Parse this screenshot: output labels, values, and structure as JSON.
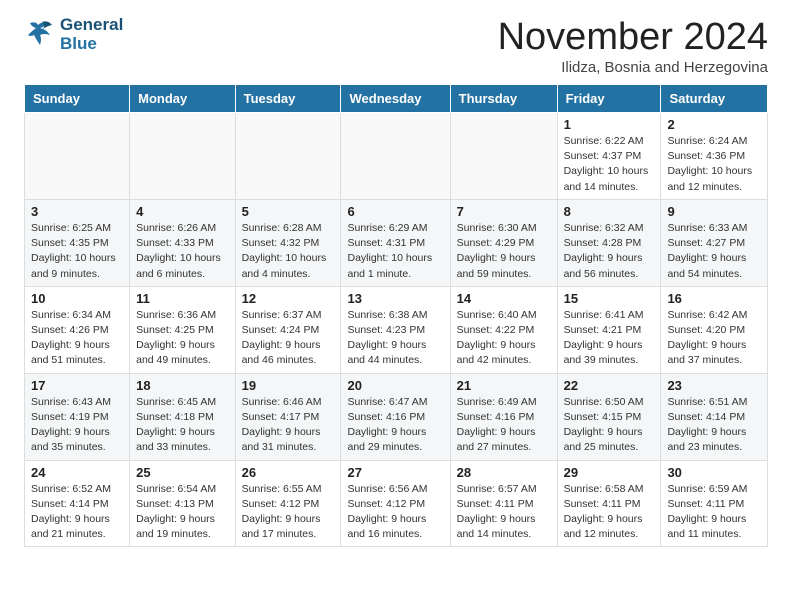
{
  "header": {
    "logo_line1": "General",
    "logo_line2": "Blue",
    "month_title": "November 2024",
    "location": "Ilidza, Bosnia and Herzegovina"
  },
  "weekdays": [
    "Sunday",
    "Monday",
    "Tuesday",
    "Wednesday",
    "Thursday",
    "Friday",
    "Saturday"
  ],
  "weeks": [
    [
      {
        "day": "",
        "info": ""
      },
      {
        "day": "",
        "info": ""
      },
      {
        "day": "",
        "info": ""
      },
      {
        "day": "",
        "info": ""
      },
      {
        "day": "",
        "info": ""
      },
      {
        "day": "1",
        "info": "Sunrise: 6:22 AM\nSunset: 4:37 PM\nDaylight: 10 hours and 14 minutes."
      },
      {
        "day": "2",
        "info": "Sunrise: 6:24 AM\nSunset: 4:36 PM\nDaylight: 10 hours and 12 minutes."
      }
    ],
    [
      {
        "day": "3",
        "info": "Sunrise: 6:25 AM\nSunset: 4:35 PM\nDaylight: 10 hours and 9 minutes."
      },
      {
        "day": "4",
        "info": "Sunrise: 6:26 AM\nSunset: 4:33 PM\nDaylight: 10 hours and 6 minutes."
      },
      {
        "day": "5",
        "info": "Sunrise: 6:28 AM\nSunset: 4:32 PM\nDaylight: 10 hours and 4 minutes."
      },
      {
        "day": "6",
        "info": "Sunrise: 6:29 AM\nSunset: 4:31 PM\nDaylight: 10 hours and 1 minute."
      },
      {
        "day": "7",
        "info": "Sunrise: 6:30 AM\nSunset: 4:29 PM\nDaylight: 9 hours and 59 minutes."
      },
      {
        "day": "8",
        "info": "Sunrise: 6:32 AM\nSunset: 4:28 PM\nDaylight: 9 hours and 56 minutes."
      },
      {
        "day": "9",
        "info": "Sunrise: 6:33 AM\nSunset: 4:27 PM\nDaylight: 9 hours and 54 minutes."
      }
    ],
    [
      {
        "day": "10",
        "info": "Sunrise: 6:34 AM\nSunset: 4:26 PM\nDaylight: 9 hours and 51 minutes."
      },
      {
        "day": "11",
        "info": "Sunrise: 6:36 AM\nSunset: 4:25 PM\nDaylight: 9 hours and 49 minutes."
      },
      {
        "day": "12",
        "info": "Sunrise: 6:37 AM\nSunset: 4:24 PM\nDaylight: 9 hours and 46 minutes."
      },
      {
        "day": "13",
        "info": "Sunrise: 6:38 AM\nSunset: 4:23 PM\nDaylight: 9 hours and 44 minutes."
      },
      {
        "day": "14",
        "info": "Sunrise: 6:40 AM\nSunset: 4:22 PM\nDaylight: 9 hours and 42 minutes."
      },
      {
        "day": "15",
        "info": "Sunrise: 6:41 AM\nSunset: 4:21 PM\nDaylight: 9 hours and 39 minutes."
      },
      {
        "day": "16",
        "info": "Sunrise: 6:42 AM\nSunset: 4:20 PM\nDaylight: 9 hours and 37 minutes."
      }
    ],
    [
      {
        "day": "17",
        "info": "Sunrise: 6:43 AM\nSunset: 4:19 PM\nDaylight: 9 hours and 35 minutes."
      },
      {
        "day": "18",
        "info": "Sunrise: 6:45 AM\nSunset: 4:18 PM\nDaylight: 9 hours and 33 minutes."
      },
      {
        "day": "19",
        "info": "Sunrise: 6:46 AM\nSunset: 4:17 PM\nDaylight: 9 hours and 31 minutes."
      },
      {
        "day": "20",
        "info": "Sunrise: 6:47 AM\nSunset: 4:16 PM\nDaylight: 9 hours and 29 minutes."
      },
      {
        "day": "21",
        "info": "Sunrise: 6:49 AM\nSunset: 4:16 PM\nDaylight: 9 hours and 27 minutes."
      },
      {
        "day": "22",
        "info": "Sunrise: 6:50 AM\nSunset: 4:15 PM\nDaylight: 9 hours and 25 minutes."
      },
      {
        "day": "23",
        "info": "Sunrise: 6:51 AM\nSunset: 4:14 PM\nDaylight: 9 hours and 23 minutes."
      }
    ],
    [
      {
        "day": "24",
        "info": "Sunrise: 6:52 AM\nSunset: 4:14 PM\nDaylight: 9 hours and 21 minutes."
      },
      {
        "day": "25",
        "info": "Sunrise: 6:54 AM\nSunset: 4:13 PM\nDaylight: 9 hours and 19 minutes."
      },
      {
        "day": "26",
        "info": "Sunrise: 6:55 AM\nSunset: 4:12 PM\nDaylight: 9 hours and 17 minutes."
      },
      {
        "day": "27",
        "info": "Sunrise: 6:56 AM\nSunset: 4:12 PM\nDaylight: 9 hours and 16 minutes."
      },
      {
        "day": "28",
        "info": "Sunrise: 6:57 AM\nSunset: 4:11 PM\nDaylight: 9 hours and 14 minutes."
      },
      {
        "day": "29",
        "info": "Sunrise: 6:58 AM\nSunset: 4:11 PM\nDaylight: 9 hours and 12 minutes."
      },
      {
        "day": "30",
        "info": "Sunrise: 6:59 AM\nSunset: 4:11 PM\nDaylight: 9 hours and 11 minutes."
      }
    ]
  ]
}
